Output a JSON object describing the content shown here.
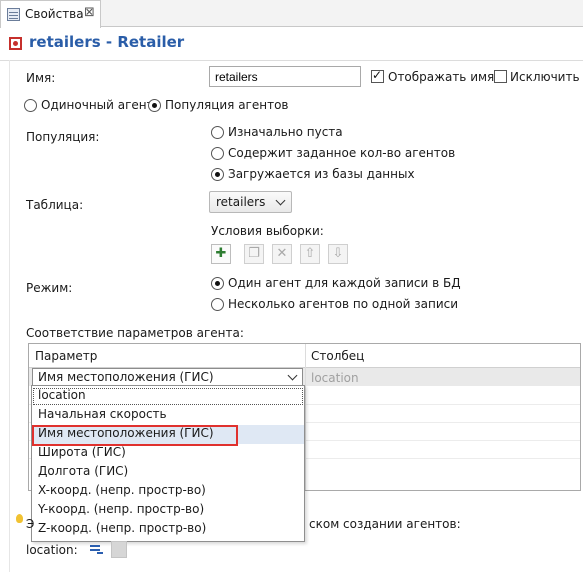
{
  "tab": {
    "label": "Свойства",
    "close": "⊠"
  },
  "header": {
    "title": "retailers - Retailer"
  },
  "name_row": {
    "label": "Имя:",
    "value": "retailers",
    "show_name_label": "Отображать имя",
    "show_name_checked": true,
    "exclude_label": "Исключить",
    "exclude_checked": false
  },
  "agent_type": {
    "single": "Одиночный агент",
    "population": "Популяция агентов",
    "selected": "population"
  },
  "population": {
    "label": "Популяция:",
    "options": [
      "Изначально пуста",
      "Содержит заданное кол-во агентов",
      "Загружается из базы данных"
    ],
    "selected_index": 2
  },
  "table_field": {
    "label": "Таблица:",
    "value": "retailers"
  },
  "selection": {
    "label": "Условия выборки:",
    "buttons": [
      "add-icon",
      "copy-icon",
      "delete-icon",
      "move-up-icon",
      "move-down-icon"
    ]
  },
  "mode": {
    "label": "Режим:",
    "options": [
      "Один агент для каждой записи в БД",
      "Несколько агентов по одной записи"
    ],
    "selected_index": 0
  },
  "mapping": {
    "label": "Соответствие параметров агента:",
    "columns": [
      "Параметр",
      "Столбец"
    ],
    "combo_value": "Имя местоположения (ГИС)",
    "column_placeholder": "location",
    "dropdown": [
      "location",
      "Начальная скорость",
      "Имя местоположения (ГИС)",
      "Широта (ГИС)",
      "Долгота (ГИС)",
      "X-коорд. (непр. простр-во)",
      "Y-коорд. (непр. простр-во)",
      "Z-коорд. (непр. простр-во)"
    ],
    "dropdown_selected": 2,
    "highlight_color": "#e0312e"
  },
  "bottom": {
    "hint_prefix": "Э",
    "hint_tail": "ском создании агентов:",
    "location_label": "location:"
  },
  "colors": {
    "title": "#2a5da8",
    "accent": "#c6302c"
  }
}
